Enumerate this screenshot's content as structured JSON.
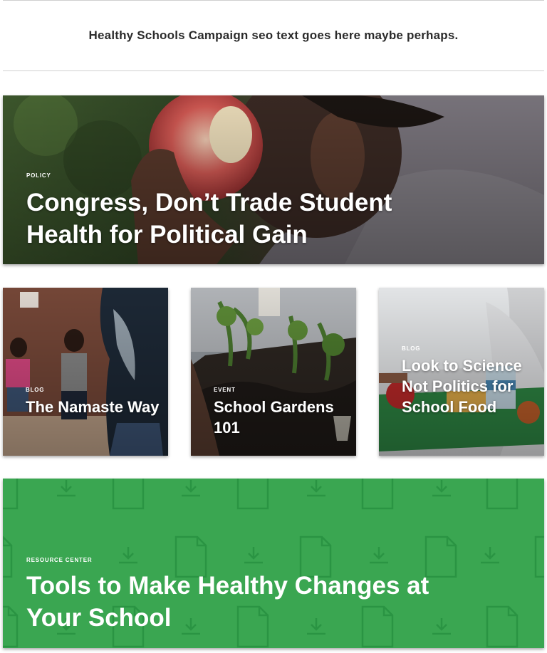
{
  "seo": {
    "text": "Healthy Schools Campaign seo text goes here maybe perhaps."
  },
  "hero": {
    "category": "POLICY",
    "title": "Congress, Don’t Trade Student Health for Political Gain"
  },
  "cards": [
    {
      "category": "BLOG",
      "title": "The Namaste Way"
    },
    {
      "category": "EVENT",
      "title": "School Gardens 101"
    },
    {
      "category": "BLOG",
      "title": "Look to Science Not Politics for School Food"
    }
  ],
  "resource": {
    "category": "RESOURCE CENTER",
    "title": "Tools to Make Healthy Changes at Your School"
  },
  "colors": {
    "resource_green": "#3aa651",
    "pattern_green": "#2a9443"
  }
}
